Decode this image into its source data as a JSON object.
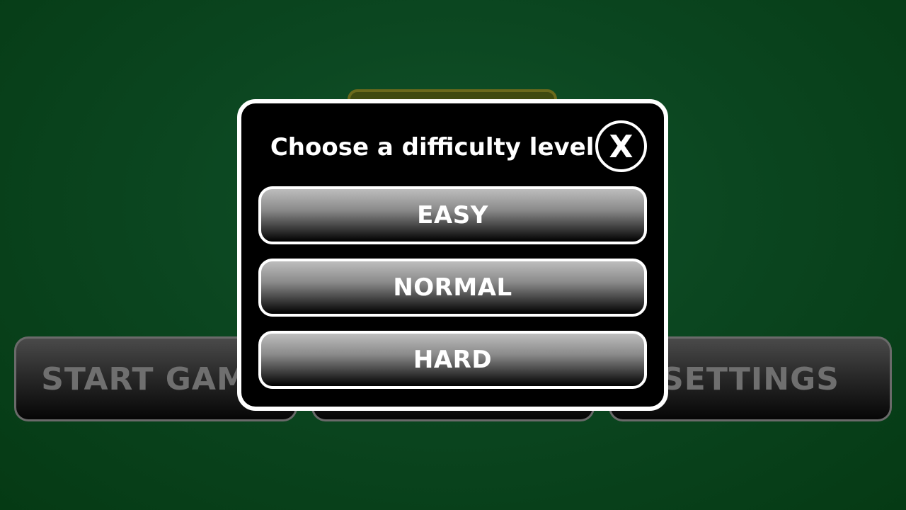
{
  "menu": {
    "start_label": "START GAME",
    "middle_label": "",
    "settings_label": "SETTINGS"
  },
  "dialog": {
    "title": "Choose a difficulty level:",
    "close_label": "X",
    "options": [
      {
        "label": "EASY"
      },
      {
        "label": "NORMAL"
      },
      {
        "label": "HARD"
      }
    ]
  },
  "colors": {
    "background": "#0b4620",
    "dialog_bg": "#000000",
    "dialog_border": "#ffffff",
    "button_text": "#ffffff",
    "menu_text_dimmed": "#6f6f6f"
  }
}
